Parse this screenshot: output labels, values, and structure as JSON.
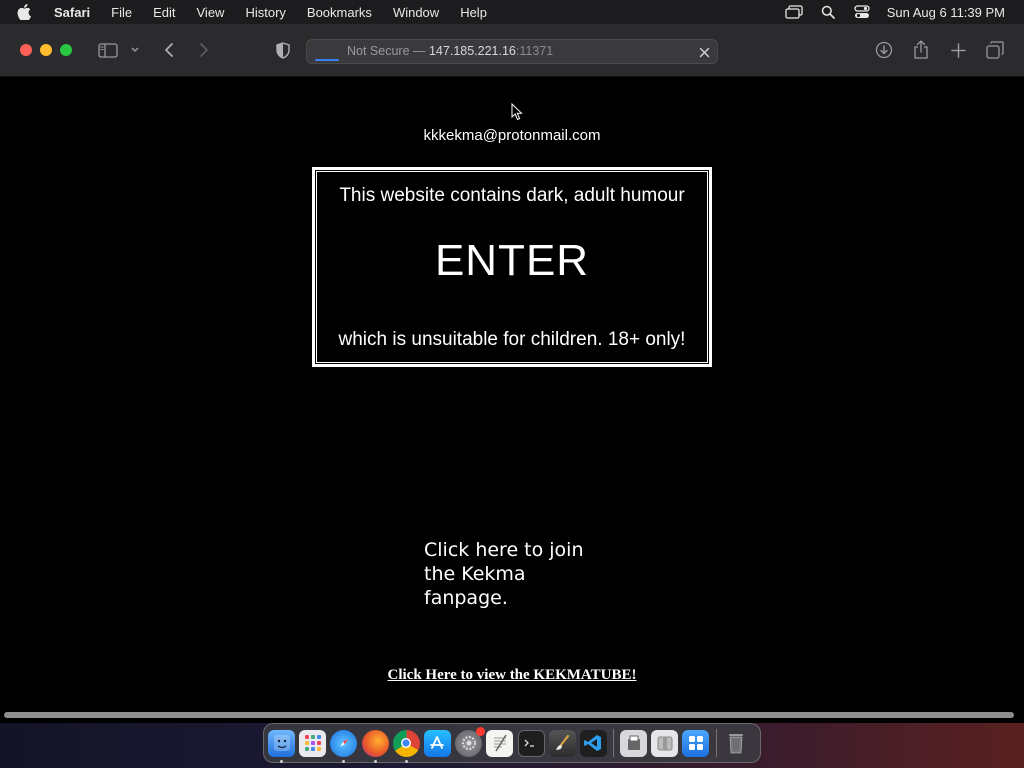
{
  "menubar": {
    "app_name": "Safari",
    "menus": [
      "File",
      "Edit",
      "View",
      "History",
      "Bookmarks",
      "Window",
      "Help"
    ],
    "clock": "Sun Aug 6  11:39 PM"
  },
  "toolbar": {
    "address": {
      "prefix": "Not Secure — ",
      "host": "147.185.221.16",
      "port": ":11371"
    }
  },
  "page": {
    "email": "kkkekma@protonmail.com",
    "banner": {
      "line1": "This website contains dark, adult humour",
      "enter": "ENTER",
      "line2": "which is unsuitable for children. 18+ only!"
    },
    "fanpage_link": "Click here to join the Kekma fanpage.",
    "kekmatube_link": "Click Here to view the KEKMATUBE!"
  },
  "dock": {
    "apps": [
      "Finder",
      "Launchpad",
      "Safari",
      "Firefox",
      "Chrome",
      "App Store",
      "System Settings",
      "TextEdit",
      "Terminal",
      "Brush",
      "Visual Studio Code",
      "Preview",
      "Archive Utility",
      "Control Panel",
      "Trash"
    ]
  }
}
